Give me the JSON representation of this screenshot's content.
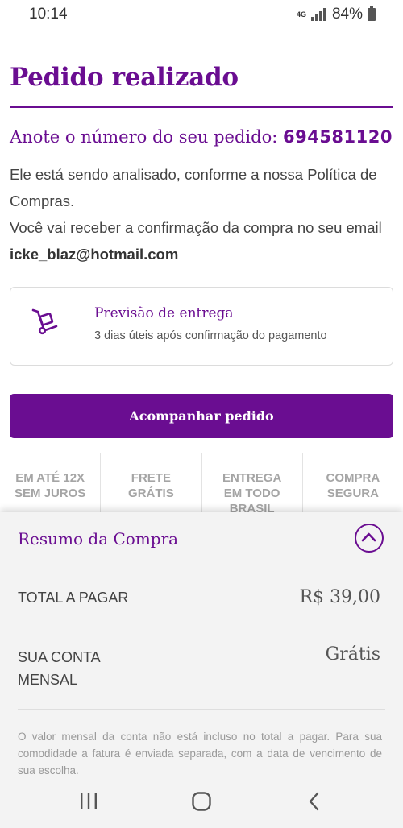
{
  "status_bar": {
    "time": "10:14",
    "network": "4G",
    "battery": "84%"
  },
  "page": {
    "title": "Pedido realizado"
  },
  "order": {
    "label": "Anote o número do seu pedido: ",
    "number": "694581120"
  },
  "info": {
    "line1": "Ele está sendo analisado, conforme a nossa Política de Compras.",
    "line2": "Você vai receber a confirmação da compra no seu email ",
    "email": "icke_blaz@hotmail.com"
  },
  "delivery": {
    "icon": "hand-truck-icon",
    "title": "Previsão de entrega",
    "subtitle": "3 dias úteis após confirmação do pagamento"
  },
  "track_button": {
    "label": "Acompanhar pedido"
  },
  "benefits": [
    {
      "line1": "EM ATÉ 12X",
      "line2": "SEM JUROS",
      "line3": ""
    },
    {
      "line1": "FRETE",
      "line2": "GRÁTIS",
      "line3": ""
    },
    {
      "line1": "ENTREGA",
      "line2": "EM TODO",
      "line3": "BRASIL"
    },
    {
      "line1": "COMPRA",
      "line2": "SEGURA",
      "line3": ""
    }
  ],
  "summary": {
    "title": "Resumo da Compra",
    "toggle_icon": "chevron-up-circle-icon",
    "total_label": "TOTAL A PAGAR",
    "total_value": "R$ 39,00",
    "monthly_label_1": "SUA CONTA",
    "monthly_label_2": "MENSAL",
    "monthly_value": "Grátis",
    "footnote": "O valor mensal da conta não está incluso no total a pagar. Para sua comodidade a fatura é enviada separada, com a data de vencimento de sua escolha."
  },
  "nav_bar": {
    "recents_icon": "recents-icon",
    "home_icon": "home-icon",
    "back_icon": "back-icon"
  },
  "colors": {
    "brand_purple": "#6a0d91",
    "muted_gray": "#a5a5a5",
    "panel_bg": "#f3f3f3"
  }
}
